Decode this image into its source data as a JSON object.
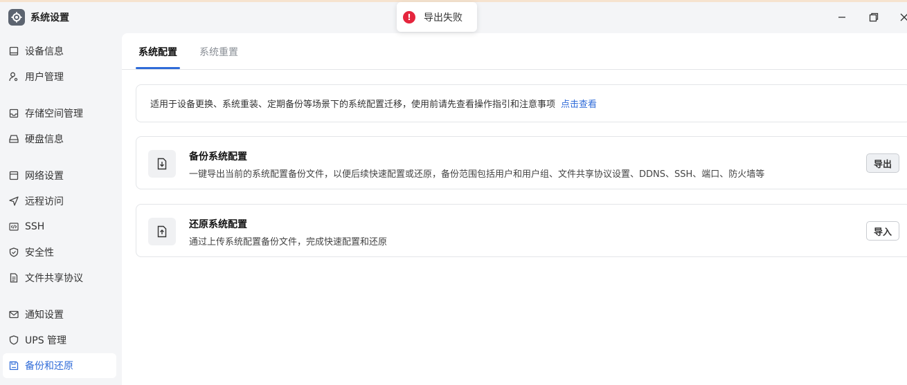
{
  "window": {
    "title": "系统设置",
    "icon": "gear-icon"
  },
  "toast": {
    "icon": "error-circle-icon",
    "text": "导出失败",
    "color": "#e5253d"
  },
  "sidebar": {
    "items": [
      {
        "label": "设备信息",
        "icon": "monitor-icon"
      },
      {
        "label": "用户管理",
        "icon": "user-key-icon"
      },
      {
        "label": "存储空间管理",
        "icon": "storage-icon"
      },
      {
        "label": "硬盘信息",
        "icon": "disk-icon"
      },
      {
        "label": "网络设置",
        "icon": "network-icon"
      },
      {
        "label": "远程访问",
        "icon": "send-icon"
      },
      {
        "label": "SSH",
        "icon": "code-icon"
      },
      {
        "label": "安全性",
        "icon": "shield-check-icon"
      },
      {
        "label": "文件共享协议",
        "icon": "document-icon"
      },
      {
        "label": "通知设置",
        "icon": "mail-icon"
      },
      {
        "label": "UPS 管理",
        "icon": "shield-icon"
      },
      {
        "label": "备份和还原",
        "icon": "save-icon",
        "active": true
      }
    ]
  },
  "tabs": [
    {
      "label": "系统配置",
      "active": true
    },
    {
      "label": "系统重置",
      "active": false
    }
  ],
  "notice": {
    "text": "适用于设备更换、系统重装、定期备份等场景下的系统配置迁移，使用前请先查看操作指引和注意事项",
    "link": "点击查看"
  },
  "cards": [
    {
      "title": "备份系统配置",
      "description": "一键导出当前的系统配置备份文件，以便后续快速配置或还原，备份范围包括用户和用户组、文件共享协议设置、DDNS、SSH、端口、防火墙等",
      "button": "导出",
      "icon": "file-export-icon"
    },
    {
      "title": "还原系统配置",
      "description": "通过上传系统配置备份文件，完成快速配置和还原",
      "button": "导入",
      "icon": "file-import-icon"
    }
  ],
  "colors": {
    "accent": "#2f6bd8",
    "error": "#e5253d"
  }
}
